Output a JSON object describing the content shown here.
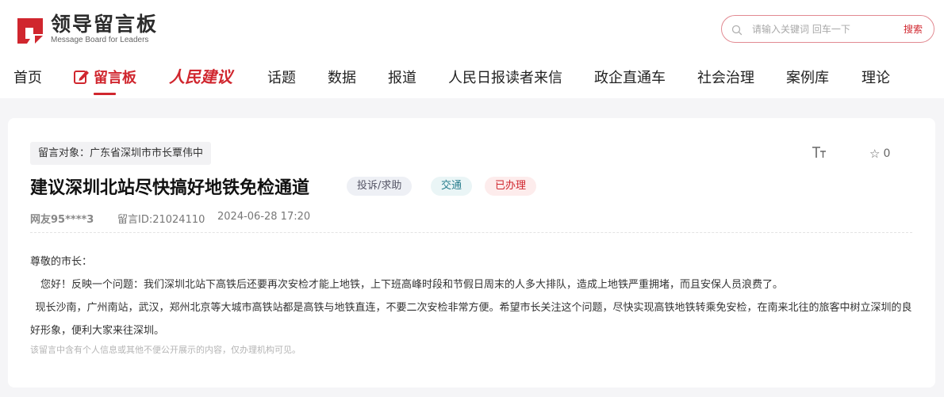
{
  "header": {
    "logo_title": "领导留言板",
    "logo_subtitle": "Message Board for Leaders",
    "brand_red": "#d0262e"
  },
  "search": {
    "placeholder": "请输入关键词 回车一下",
    "button_label": "搜索"
  },
  "nav": {
    "items": [
      {
        "label": "首页"
      },
      {
        "label": "留言板",
        "active": true
      },
      {
        "label": "人民建议"
      },
      {
        "label": "话题"
      },
      {
        "label": "数据"
      },
      {
        "label": "报道"
      },
      {
        "label": "人民日报读者来信"
      },
      {
        "label": "政企直通车"
      },
      {
        "label": "社会治理"
      },
      {
        "label": "案例库"
      },
      {
        "label": "理论"
      }
    ]
  },
  "message": {
    "target": "留言对象：广东省深圳市市长覃伟中",
    "font_toggle": "TT",
    "fav_count": "0",
    "title": "建议深圳北站尽快搞好地铁免检通道",
    "tags": [
      "投诉/求助",
      "交通",
      "已办理"
    ],
    "user": "网友95****3",
    "message_id": "留言ID:21024110",
    "time": "2024-06-28 17:20",
    "salutation": "尊敬的市长：",
    "paragraph1": "您好！反映一个问题：我们深圳北站下高铁后还要再次安检才能上地铁，上下班高峰时段和节假日周末的人多大排队，造成上地铁严重拥堵，而且安保人员浪费了。",
    "paragraph2": "现长沙南，广州南站，武汉，郑州北京等大城市高铁站都是高铁与地铁直连，不要二次安检非常方便。希望市长关注这个问题，尽快实现高铁地铁转乘免安检，在南来北往的旅客中树立深圳的良好形象，便利大家来往深圳。",
    "privacy_note": "该留言中含有个人信息或其他不便公开展示的内容，仅办理机构可见。"
  }
}
